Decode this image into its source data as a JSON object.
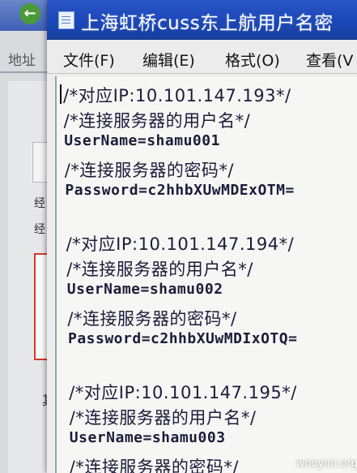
{
  "background_window": {
    "address_label": "地址",
    "side_text": [
      "经",
      "经"
    ],
    "bottom_text": "其"
  },
  "window": {
    "title": "上海虹桥cuss东上航用户名密"
  },
  "menu": [
    {
      "label": "文件(F)"
    },
    {
      "label": "编辑(E)"
    },
    {
      "label": "格式(O)"
    },
    {
      "label": "查看(V"
    }
  ],
  "editor": {
    "lines": [
      "/*对应IP:10.101.147.193*/",
      "/*连接服务器的用户名*/",
      "UserName=shamu001",
      "/*连接服务器的密码*/",
      "Password=c2hhbXUwMDExOTM=",
      "",
      "/*对应IP:10.101.147.194*/",
      "/*连接服务器的用户名*/",
      "UserName=shamu002",
      "/*连接服务器的密码*/",
      "Password=c2hhbXUwMDIxOTQ=",
      "",
      "/*对应IP:10.101.147.195*/",
      "/*连接服务器的用户名*/",
      "UserName=shamu003",
      "/*连接服务器的密码*/"
    ]
  },
  "watermark": "wooyun.org"
}
